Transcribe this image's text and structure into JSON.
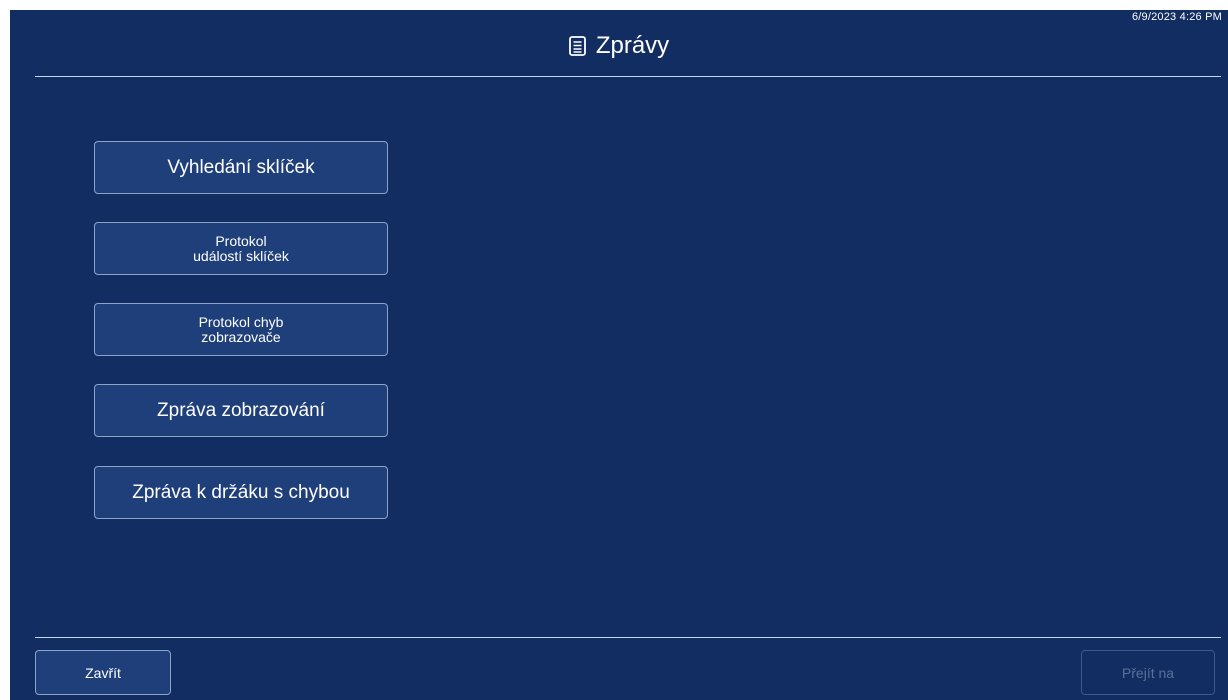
{
  "app": {
    "timestamp": "6/9/2023 4:26 PM"
  },
  "header": {
    "title": "Zprávy",
    "icon": "document-icon"
  },
  "menu": {
    "items": [
      {
        "label": "Vyhledání sklíček"
      },
      {
        "label": "Protokol\nudálostí sklíček"
      },
      {
        "label": "Protokol chyb\nzobrazovače"
      },
      {
        "label": "Zpráva zobrazování"
      },
      {
        "label": "Zpráva k držáku s chybou"
      }
    ]
  },
  "footer": {
    "close_label": "Zavřít",
    "goto_label": "Přejít na",
    "goto_enabled": false
  },
  "colors": {
    "background": "#122d61",
    "button": "#1f3f7a",
    "button_border": "#8ea3c9",
    "disabled_text": "#5b6f98"
  }
}
